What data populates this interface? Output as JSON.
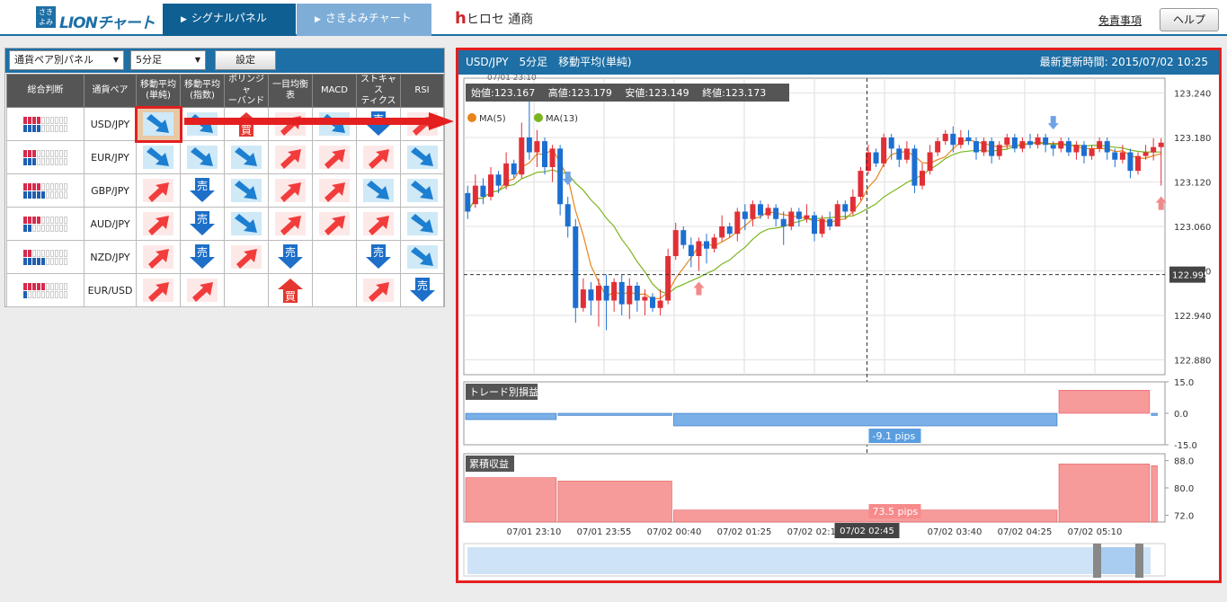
{
  "header": {
    "logo_box": "さき\nよみ",
    "logo_text": "LIONチャート",
    "tabs": [
      {
        "label": "シグナルパネル",
        "active": true
      },
      {
        "label": "さきよみチャート",
        "active": false
      }
    ],
    "brand_h": "h",
    "brand_text": "ヒロセ 通商",
    "disclaimer": "免責事項",
    "help": "ヘルプ"
  },
  "panel": {
    "mode_select": "通貨ペア別パネル",
    "period_select": "5分足",
    "set_button": "設定",
    "columns": [
      "総合判断",
      "通貨ペア",
      "移動平均\n(単純)",
      "移動平均\n(指数)",
      "ボリンジャ\nーバンド",
      "一目均衡\n表",
      "MACD",
      "ストキャス\nティクス",
      "RSI"
    ],
    "rows": [
      {
        "pair": "USD/JPY",
        "meter": {
          "red": 4,
          "blue": 4
        },
        "signals": [
          "down",
          "down",
          "up-buy",
          "up",
          "down",
          "down-sell",
          "up"
        ]
      },
      {
        "pair": "EUR/JPY",
        "meter": {
          "red": 3,
          "blue": 3
        },
        "signals": [
          "down",
          "down",
          "down",
          "up",
          "up",
          "up",
          "down"
        ]
      },
      {
        "pair": "GBP/JPY",
        "meter": {
          "red": 4,
          "blue": 5
        },
        "signals": [
          "up",
          "sell",
          "down",
          "up",
          "up",
          "down",
          "down"
        ]
      },
      {
        "pair": "AUD/JPY",
        "meter": {
          "red": 4,
          "blue": 2
        },
        "signals": [
          "up",
          "sell",
          "down",
          "up",
          "up",
          "up",
          "down"
        ]
      },
      {
        "pair": "NZD/JPY",
        "meter": {
          "red": 2,
          "blue": 5
        },
        "signals": [
          "up",
          "sell",
          "up",
          "sell",
          "",
          "sell",
          "down"
        ]
      },
      {
        "pair": "EUR/USD",
        "meter": {
          "red": 5,
          "blue": 1
        },
        "signals": [
          "up",
          "up",
          "",
          "buy",
          "",
          "up",
          "sell"
        ]
      }
    ],
    "badge_sell": "売",
    "badge_buy": "買"
  },
  "chart": {
    "title": "USD/JPY　5分足　移動平均(単純)",
    "updated": "最新更新時間: 2015/07/02 10:25",
    "ohlc_label": "始値:123.167　 高値:123.179　 安値:123.149　 終値:123.173",
    "top_date": "07/01 23:10",
    "cursor_time": "07/02 02:45",
    "cursor_price": "122.995",
    "sub1_title": "トレード別損益",
    "sub1_value": "-9.1 pips",
    "sub2_title": "累積収益",
    "sub2_value": "73.5 pips"
  },
  "chart_data": {
    "type": "candlestick",
    "series": [
      {
        "name": "MA(5)",
        "color": "#e8841a"
      },
      {
        "name": "MA(13)",
        "color": "#7ab51d"
      }
    ],
    "y_ticks": [
      "123.240",
      "123.180",
      "123.120",
      "123.060",
      "123.000",
      "122.940",
      "122.880"
    ],
    "ylim": [
      122.86,
      123.26
    ],
    "x_ticks": [
      "07/01 23:10",
      "07/01 23:55",
      "07/02 00:40",
      "07/02 01:25",
      "07/02 02:10",
      "07/02 02:45",
      "07/02 03:40",
      "07/02 04:25",
      "07/02 05:10"
    ],
    "candles": [
      [
        123.105,
        123.08,
        123.115,
        123.07
      ],
      [
        123.09,
        123.115,
        123.13,
        123.085
      ],
      [
        123.115,
        123.1,
        123.125,
        123.09
      ],
      [
        123.1,
        123.13,
        123.14,
        123.095
      ],
      [
        123.13,
        123.115,
        123.135,
        123.105
      ],
      [
        123.115,
        123.145,
        123.16,
        123.11
      ],
      [
        123.145,
        123.13,
        123.15,
        123.125
      ],
      [
        123.13,
        123.18,
        123.2,
        123.125
      ],
      [
        123.18,
        123.16,
        123.24,
        123.15
      ],
      [
        123.16,
        123.175,
        123.19,
        123.14
      ],
      [
        123.175,
        123.14,
        123.18,
        123.13
      ],
      [
        123.14,
        123.165,
        123.17,
        123.12
      ],
      [
        123.165,
        123.09,
        123.17,
        123.075
      ],
      [
        123.09,
        123.06,
        123.1,
        123.045
      ],
      [
        123.06,
        122.95,
        123.07,
        122.93
      ],
      [
        122.95,
        122.975,
        122.99,
        122.945
      ],
      [
        122.975,
        122.96,
        122.985,
        122.94
      ],
      [
        122.96,
        122.98,
        122.99,
        122.925
      ],
      [
        122.98,
        122.96,
        122.995,
        122.92
      ],
      [
        122.96,
        122.985,
        122.99,
        122.945
      ],
      [
        122.985,
        122.955,
        122.995,
        122.94
      ],
      [
        122.955,
        122.98,
        122.99,
        122.935
      ],
      [
        122.98,
        122.96,
        122.985,
        122.945
      ],
      [
        122.96,
        122.965,
        122.975,
        122.94
      ],
      [
        122.965,
        122.95,
        122.97,
        122.945
      ],
      [
        122.95,
        122.96,
        122.975,
        122.94
      ],
      [
        122.96,
        123.02,
        123.03,
        122.955
      ],
      [
        123.02,
        123.055,
        123.065,
        123.015
      ],
      [
        123.055,
        123.035,
        123.06,
        123.03
      ],
      [
        123.035,
        123.02,
        123.045,
        123.005
      ],
      [
        123.02,
        123.04,
        123.045,
        123.0
      ],
      [
        123.04,
        123.03,
        123.05,
        123.01
      ],
      [
        123.03,
        123.045,
        123.05,
        123.025
      ],
      [
        123.045,
        123.06,
        123.075,
        123.04
      ],
      [
        123.06,
        123.05,
        123.065,
        123.045
      ],
      [
        123.05,
        123.08,
        123.085,
        123.04
      ],
      [
        123.08,
        123.07,
        123.09,
        123.055
      ],
      [
        123.07,
        123.09,
        123.095,
        123.06
      ],
      [
        123.09,
        123.075,
        123.095,
        123.07
      ],
      [
        123.075,
        123.085,
        123.09,
        123.07
      ],
      [
        123.085,
        123.07,
        123.09,
        123.06
      ],
      [
        123.07,
        123.06,
        123.08,
        123.035
      ],
      [
        123.06,
        123.08,
        123.085,
        123.055
      ],
      [
        123.08,
        123.07,
        123.085,
        123.06
      ],
      [
        123.07,
        123.075,
        123.09,
        123.065
      ],
      [
        123.075,
        123.05,
        123.08,
        123.04
      ],
      [
        123.05,
        123.07,
        123.075,
        123.045
      ],
      [
        123.07,
        123.06,
        123.08,
        123.055
      ],
      [
        123.06,
        123.09,
        123.095,
        123.06
      ],
      [
        123.09,
        123.08,
        123.095,
        123.07
      ],
      [
        123.08,
        123.1,
        123.11,
        123.075
      ],
      [
        123.1,
        123.135,
        123.14,
        123.095
      ],
      [
        123.135,
        123.16,
        123.17,
        123.13
      ],
      [
        123.16,
        123.145,
        123.165,
        123.14
      ],
      [
        123.145,
        123.18,
        123.185,
        123.14
      ],
      [
        123.18,
        123.165,
        123.185,
        123.15
      ],
      [
        123.165,
        123.15,
        123.17,
        123.14
      ],
      [
        123.15,
        123.165,
        123.175,
        123.145
      ],
      [
        123.165,
        123.115,
        123.17,
        123.105
      ],
      [
        123.115,
        123.135,
        123.145,
        123.11
      ],
      [
        123.135,
        123.16,
        123.17,
        123.13
      ],
      [
        123.16,
        123.175,
        123.18,
        123.155
      ],
      [
        123.175,
        123.185,
        123.19,
        123.17
      ],
      [
        123.185,
        123.17,
        123.195,
        123.16
      ],
      [
        123.17,
        123.18,
        123.19,
        123.165
      ],
      [
        123.18,
        123.175,
        123.19,
        123.17
      ],
      [
        123.175,
        123.16,
        123.18,
        123.15
      ],
      [
        123.16,
        123.175,
        123.18,
        123.155
      ],
      [
        123.175,
        123.155,
        123.18,
        123.145
      ],
      [
        123.155,
        123.17,
        123.175,
        123.15
      ],
      [
        123.17,
        123.18,
        123.185,
        123.165
      ],
      [
        123.18,
        123.165,
        123.185,
        123.16
      ],
      [
        123.165,
        123.175,
        123.18,
        123.16
      ],
      [
        123.175,
        123.17,
        123.185,
        123.165
      ],
      [
        123.17,
        123.18,
        123.185,
        123.165
      ],
      [
        123.18,
        123.17,
        123.185,
        123.16
      ],
      [
        123.17,
        123.165,
        123.175,
        123.155
      ],
      [
        123.165,
        123.175,
        123.18,
        123.16
      ],
      [
        123.175,
        123.16,
        123.18,
        123.155
      ],
      [
        123.16,
        123.17,
        123.175,
        123.15
      ],
      [
        123.17,
        123.155,
        123.175,
        123.145
      ],
      [
        123.155,
        123.165,
        123.17,
        123.15
      ],
      [
        123.165,
        123.175,
        123.18,
        123.16
      ],
      [
        123.175,
        123.16,
        123.18,
        123.15
      ],
      [
        123.16,
        123.15,
        123.165,
        123.14
      ],
      [
        123.15,
        123.16,
        123.17,
        123.145
      ],
      [
        123.16,
        123.135,
        123.165,
        123.125
      ],
      [
        123.135,
        123.155,
        123.16,
        123.13
      ],
      [
        123.155,
        123.16,
        123.17,
        123.15
      ],
      [
        123.16,
        123.167,
        123.179,
        123.149
      ],
      [
        123.167,
        123.173,
        123.179,
        123.115
      ]
    ],
    "signals": [
      {
        "index": 13,
        "dir": "down"
      },
      {
        "index": 30,
        "dir": "up"
      },
      {
        "index": 76,
        "dir": "down"
      },
      {
        "index": 90,
        "dir": "up"
      }
    ],
    "trade_pnl": {
      "ylim": [
        -15,
        15
      ],
      "ticks": [
        "15.0",
        "0.0",
        "-15.0"
      ],
      "segments": [
        [
          0,
          12,
          -3
        ],
        [
          12,
          27,
          -1
        ],
        [
          27,
          77,
          -6
        ],
        [
          77,
          89,
          11
        ],
        [
          89,
          90,
          -1
        ]
      ]
    },
    "cumulative": {
      "ylim": [
        70,
        90
      ],
      "ticks": [
        "88.0",
        "80.0",
        "72.0"
      ],
      "segments": [
        [
          0,
          12,
          83
        ],
        [
          12,
          27,
          82
        ],
        [
          27,
          77,
          73.5
        ],
        [
          77,
          89,
          87
        ],
        [
          89,
          90,
          86.5
        ]
      ]
    }
  }
}
